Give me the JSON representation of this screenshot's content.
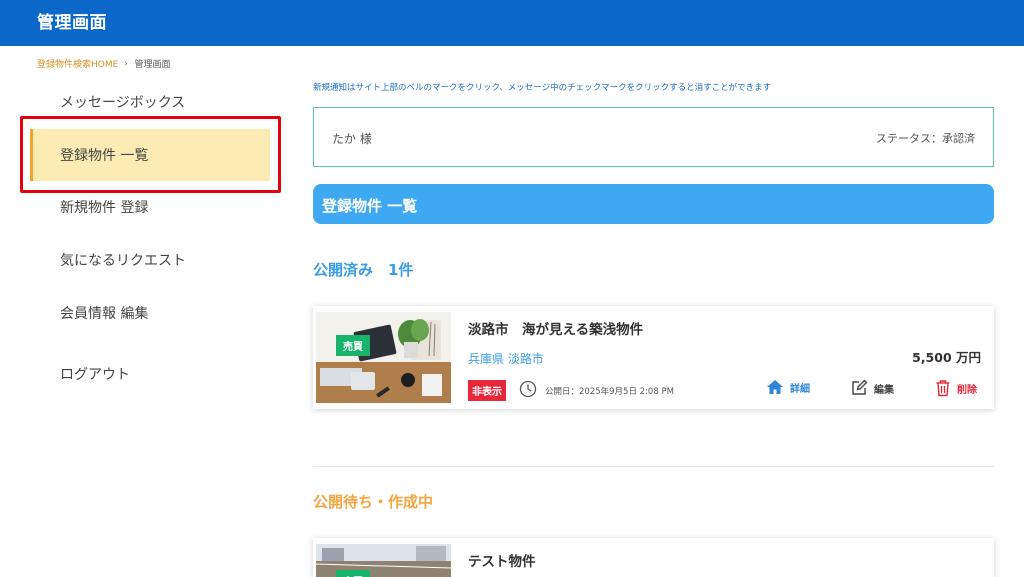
{
  "header": {
    "title": "管理画面"
  },
  "breadcrumb": {
    "home": "登録物件検索HOME",
    "separator": "›",
    "current": "管理画面"
  },
  "sidebar": {
    "items": [
      {
        "label": "メッセージボックス",
        "active": false
      },
      {
        "label": "登録物件 一覧",
        "active": true
      },
      {
        "label": "新規物件 登録",
        "active": false
      },
      {
        "label": "気になるリクエスト",
        "active": false
      },
      {
        "label": "会員情報 編集",
        "active": false
      },
      {
        "label": "ログアウト",
        "active": false
      }
    ]
  },
  "notice": "新規通知はサイト上部のベルのマークをクリック、メッセージ中のチェックマークをクリックすると消すことができます",
  "user": {
    "name": "たか 様",
    "status": "ステータス：承認済"
  },
  "list_bar": {
    "title": "登録物件 一覧"
  },
  "sections": {
    "published": {
      "title": "公開済み　1件"
    },
    "pending": {
      "title": "公開待ち・作成中"
    }
  },
  "properties": [
    {
      "tag": "売買",
      "title": "淡路市　海が見える築浅物件",
      "location": "兵庫県 淡路市",
      "price": "5,500 万円",
      "visibility": "非表示",
      "date": "公開日：2025年9月5日 2:08 PM",
      "actions": {
        "detail": "詳細",
        "edit": "編集",
        "delete": "削除"
      }
    },
    {
      "tag": "売買",
      "title": "テスト物件"
    }
  ],
  "colors": {
    "header": "#0b68c8",
    "accent_blue": "#3fa8f3",
    "highlight_red": "#e3000f",
    "active_bg": "#fcecb3",
    "pending_orange": "#f4a540",
    "sale_green": "#19b36b"
  }
}
